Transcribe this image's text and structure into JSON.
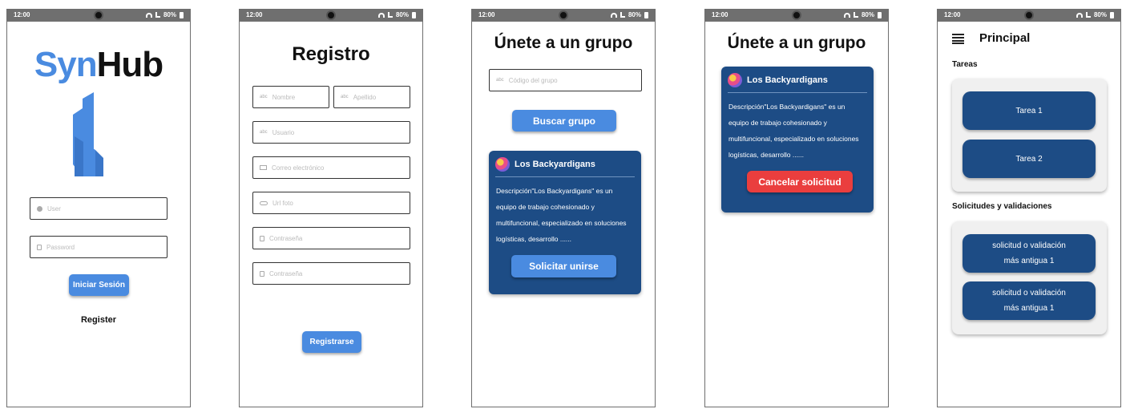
{
  "status_bar": {
    "time": "12:00",
    "battery": "80%"
  },
  "login": {
    "logo_syn": "Syn",
    "logo_hub": "Hub",
    "user_placeholder": "User",
    "password_placeholder": "Password",
    "login_button": "Iniciar Sesión",
    "register_link": "Register"
  },
  "registro": {
    "title": "Registro",
    "fields": {
      "nombre": "Nombre",
      "apellido": "Apellido",
      "usuario": "Usuario",
      "correo": "Correo electrónico",
      "url_foto": "Url foto",
      "contrasena": "Contraseña",
      "confirmar": "Contraseña"
    },
    "submit_button": "Registrarse"
  },
  "join_group": {
    "title": "Únete a un grupo",
    "code_placeholder": "Código del grupo",
    "search_button": "Buscar grupo",
    "group_name": "Los Backyardigans",
    "group_description": "Descripción\"Los Backyardigans\" es un equipo de trabajo cohesionado y multifuncional, especializado en soluciones logísticas, desarrollo ......",
    "request_button": "Solicitar unirse"
  },
  "pending": {
    "title": "Únete a un grupo",
    "group_name": "Los Backyardigans",
    "group_description": "Descripción\"Los Backyardigans\" es un equipo de trabajo cohesionado y multifuncional, especializado en soluciones logísticas, desarrollo ......",
    "cancel_button": "Cancelar solicitud"
  },
  "principal": {
    "title": "Principal",
    "tasks_label": "Tareas",
    "tasks": [
      "Tarea 1",
      "Tarea 2"
    ],
    "requests_label": "Solicitudes y validaciones",
    "requests": [
      "solicitud o validación más antigua 1",
      "solicitud o validación más antigua 1"
    ]
  },
  "colors": {
    "primary": "#4a8be0",
    "card": "#1d4c85",
    "danger": "#ea3e3e"
  }
}
